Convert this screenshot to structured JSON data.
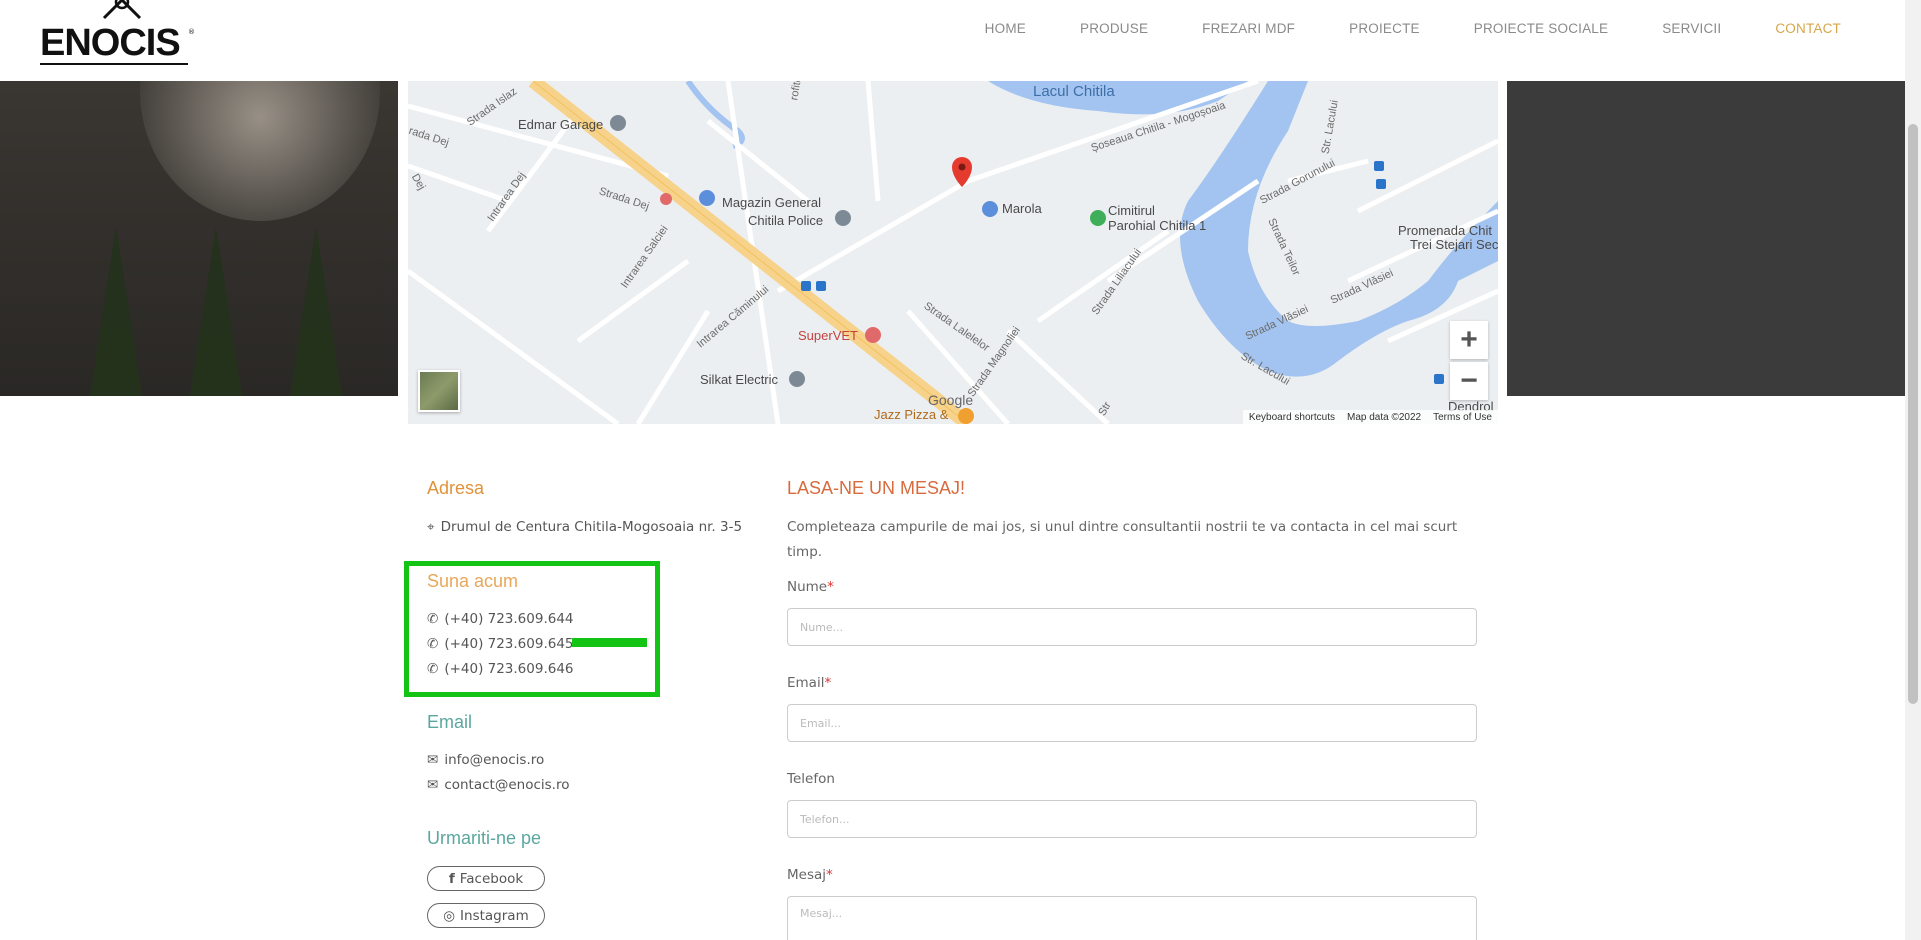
{
  "header": {
    "logo_text": "ENOCIS",
    "logo_mark": "®",
    "nav": [
      {
        "label": "HOME"
      },
      {
        "label": "PRODUSE"
      },
      {
        "label": "FREZARI MDF"
      },
      {
        "label": "PROIECTE"
      },
      {
        "label": "PROIECTE SOCIALE"
      },
      {
        "label": "SERVICII"
      },
      {
        "label": "CONTACT",
        "active": true
      }
    ]
  },
  "map": {
    "labels": {
      "lake": "Lacul Chitila",
      "edmar": "Edmar Garage",
      "magazin": "Magazin General",
      "police": "Chitila Police",
      "marola": "Marola",
      "cimitir1": "Cimitirul",
      "cimitir2": "Parohial Chitila 1",
      "supervet": "SuperVET",
      "silkat": "Silkat Electric",
      "jazz": "Jazz Pizza &",
      "promenada1": "Promenada Chit",
      "promenada2": "Trei Stejari Sec",
      "dendro": "Dendrol",
      "str_islaz": "Strada Islaz",
      "str_dej": "Strada Dej",
      "str_dej2": "Strada Dej",
      "intr_dej": "Intrarea Dej",
      "intr_salciei": "Intrarea Salciei",
      "intr_caminului": "Intrarea Căminului",
      "str_lalelelor": "Strada Lalelelor",
      "str_magnoliei": "Strada Magnoliei",
      "str_liliacului": "Strada Liliacului",
      "soseaua": "Șoseaua Chitila - Mogoșoaia",
      "str_lacului": "Str. Lacului",
      "str_lacului2": "Str. Lacului",
      "str_gorunului": "Strada Gorunului",
      "str_teilor": "Strada Teilor",
      "str_vlasiei": "Strada Vlăsiei",
      "str_vlasiei2": "Strada Vlăsiei",
      "dej_left": "rada Dej",
      "dej_vert": "Dej",
      "strofitei": "rofitei",
      "str": "Str"
    },
    "google": "Google",
    "footer": {
      "shortcuts": "Keyboard shortcuts",
      "mapdata": "Map data ©2022",
      "terms": "Terms of Use"
    },
    "zoom_in": "+",
    "zoom_out": "−"
  },
  "contact": {
    "address_title": "Adresa",
    "address": "Drumul de Centura Chitila-Mogosoaia nr. 3-5",
    "phone_title": "Suna acum",
    "phones": [
      "(+40) 723.609.644",
      "(+40) 723.609.645",
      "(+40) 723.609.646"
    ],
    "email_title": "Email",
    "emails": [
      "info@enocis.ro",
      "contact@enocis.ro"
    ],
    "follow_title": "Urmariti-ne pe",
    "facebook": "Facebook",
    "instagram": "Instagram"
  },
  "form": {
    "title": "LASA-NE UN MESAJ!",
    "description": "Completeaza campurile de mai jos, si unul dintre consultantii nostrii te va contacta in cel mai scurt timp.",
    "fields": {
      "nume": {
        "label": "Nume",
        "required": "*",
        "placeholder": "Nume..."
      },
      "email": {
        "label": "Email",
        "required": "*",
        "placeholder": "Email..."
      },
      "telefon": {
        "label": "Telefon",
        "placeholder": "Telefon..."
      },
      "mesaj": {
        "label": "Mesaj",
        "required": "*",
        "placeholder": "Mesaj..."
      }
    }
  },
  "colors": {
    "accent_nav": "#d7a548",
    "orange": "#e0933a",
    "teal": "#5ba7a0",
    "highlight": "#14c414",
    "form_title": "#d86a3d"
  },
  "icons": [
    "map-marker-icon",
    "phone-icon",
    "envelope-icon",
    "facebook-icon",
    "instagram-icon",
    "zoom-in-icon",
    "zoom-out-icon",
    "map-pin-icon"
  ]
}
